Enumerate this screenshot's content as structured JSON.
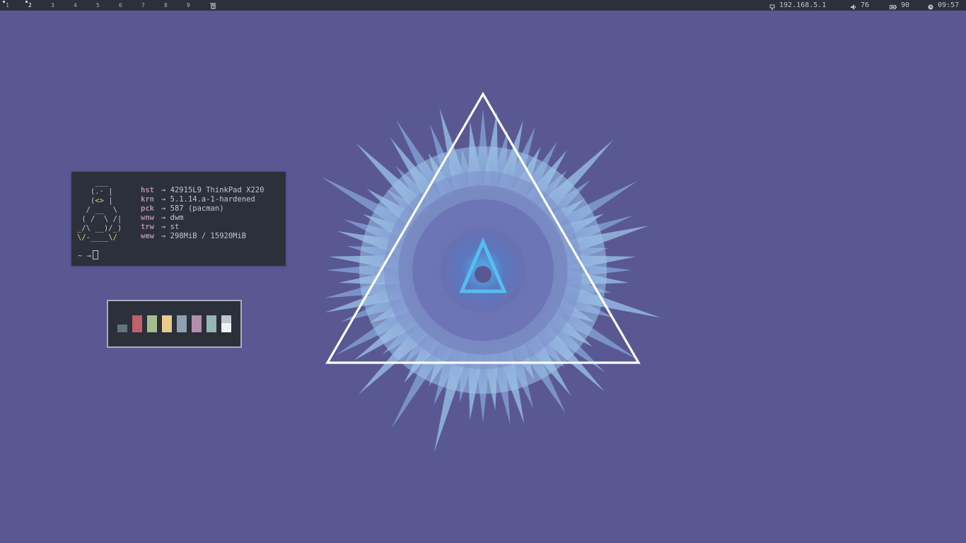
{
  "bar": {
    "tags": [
      {
        "label": "1",
        "selected": false,
        "occupied": true
      },
      {
        "label": "2",
        "selected": true,
        "occupied": true
      },
      {
        "label": "3",
        "selected": false,
        "occupied": false
      },
      {
        "label": "4",
        "selected": false,
        "occupied": false
      },
      {
        "label": "5",
        "selected": false,
        "occupied": false
      },
      {
        "label": "6",
        "selected": false,
        "occupied": false
      },
      {
        "label": "7",
        "selected": false,
        "occupied": false
      },
      {
        "label": "8",
        "selected": false,
        "occupied": false
      },
      {
        "label": "9",
        "selected": false,
        "occupied": false
      }
    ],
    "layout_icon": "layout-spiral-icon",
    "ip": "192.168.5.1",
    "volume": "76",
    "battery": "90",
    "clock": "09:57",
    "colors": {
      "bg": "#2b303b",
      "fg": "#c0c5ce"
    }
  },
  "terminal": {
    "info": [
      {
        "key": "hst",
        "value": "42915L9 ThinkPad X220"
      },
      {
        "key": "krn",
        "value": "5.1.14.a-1-hardened"
      },
      {
        "key": "pck",
        "value": "587 (pacman)"
      },
      {
        "key": "wnw",
        "value": "dwm"
      },
      {
        "key": "trw",
        "value": "st"
      },
      {
        "key": "wew",
        "value": "298MiB / 15920MiB"
      }
    ],
    "arrow": "→",
    "prompt": "~ →",
    "colors": {
      "bg": "#2b303b",
      "key": "#b48ead",
      "tux_accent": "#ebcb8b"
    }
  },
  "palette": {
    "swatches": [
      "#65737e",
      "#bf616a",
      "#a3be8c",
      "#ebcb8b",
      "#8fa1b3",
      "#b48ead",
      "#96b5b4",
      "#eff1f5"
    ]
  },
  "desktop": {
    "background": "#5a5893"
  }
}
